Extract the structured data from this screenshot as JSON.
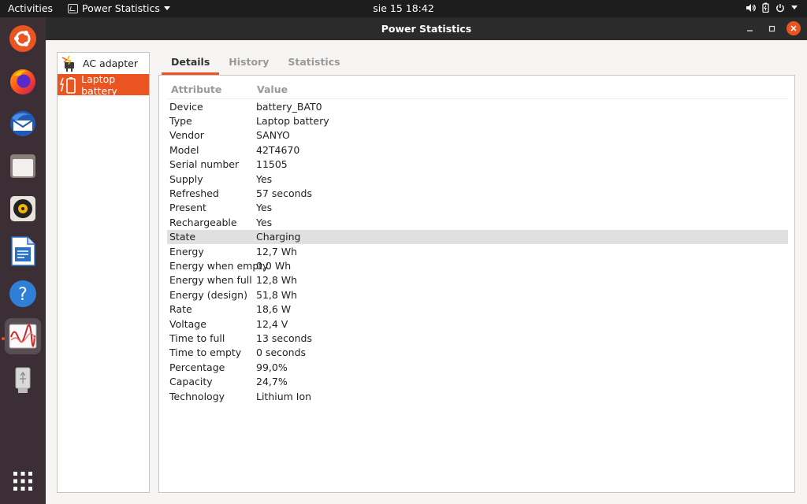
{
  "topbar": {
    "activities": "Activities",
    "app_name": "Power Statistics",
    "clock": "sie 15  18:42"
  },
  "dock": {
    "items": [
      "ubuntu-software",
      "firefox",
      "thunderbird",
      "files",
      "rhythmbox",
      "libreoffice-writer",
      "help",
      "power-statistics",
      "usb-drive"
    ],
    "active": "power-statistics"
  },
  "window": {
    "title": "Power Statistics"
  },
  "devices": [
    {
      "label": "AC adapter",
      "icon": "ac-adapter-icon"
    },
    {
      "label": "Laptop battery",
      "icon": "battery-icon",
      "selected": true
    }
  ],
  "tabs": [
    {
      "label": "Details",
      "active": true
    },
    {
      "label": "History"
    },
    {
      "label": "Statistics"
    }
  ],
  "table": {
    "headers": {
      "attribute": "Attribute",
      "value": "Value"
    },
    "rows": [
      {
        "attr": "Device",
        "value": "battery_BAT0"
      },
      {
        "attr": "Type",
        "value": "Laptop battery"
      },
      {
        "attr": "Vendor",
        "value": "SANYO"
      },
      {
        "attr": "Model",
        "value": "42T4670"
      },
      {
        "attr": "Serial number",
        "value": "11505"
      },
      {
        "attr": "Supply",
        "value": "Yes"
      },
      {
        "attr": "Refreshed",
        "value": "57 seconds"
      },
      {
        "attr": "Present",
        "value": "Yes"
      },
      {
        "attr": "Rechargeable",
        "value": "Yes"
      },
      {
        "attr": "State",
        "value": "Charging",
        "selected": true
      },
      {
        "attr": "Energy",
        "value": "12,7 Wh"
      },
      {
        "attr": "Energy when empty",
        "value": "0,0 Wh"
      },
      {
        "attr": "Energy when full",
        "value": "12,8 Wh"
      },
      {
        "attr": "Energy (design)",
        "value": "51,8 Wh"
      },
      {
        "attr": "Rate",
        "value": "18,6 W"
      },
      {
        "attr": "Voltage",
        "value": "12,4 V"
      },
      {
        "attr": "Time to full",
        "value": "13 seconds"
      },
      {
        "attr": "Time to empty",
        "value": "0 seconds"
      },
      {
        "attr": "Percentage",
        "value": "99,0%"
      },
      {
        "attr": "Capacity",
        "value": "24,7%"
      },
      {
        "attr": "Technology",
        "value": "Lithium Ion"
      }
    ]
  },
  "colors": {
    "accent": "#e95420",
    "dock_bg": "#3b2e35",
    "topbar_bg": "#1d1d1d",
    "titlebar_bg": "#2b2b2b"
  }
}
